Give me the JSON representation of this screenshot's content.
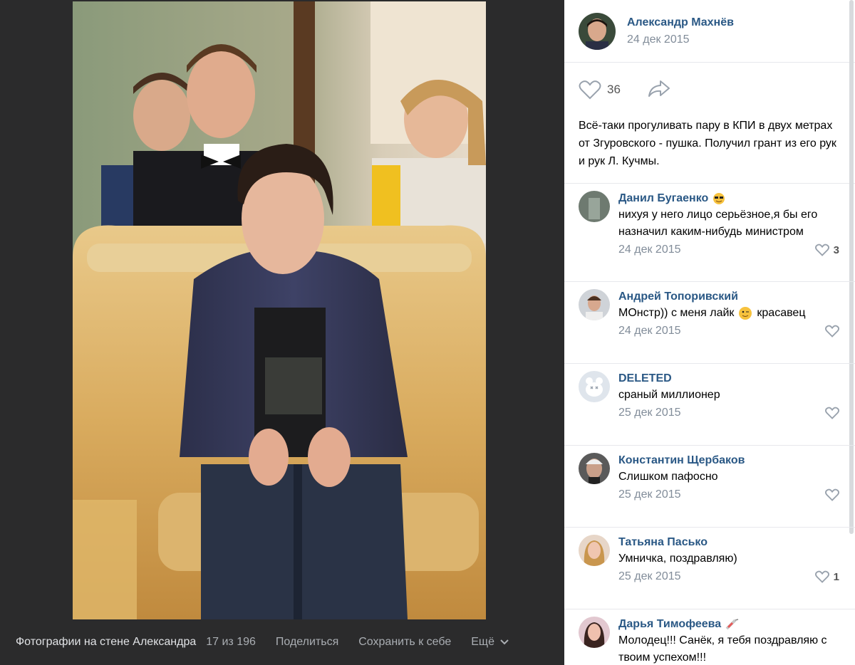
{
  "viewer": {
    "album_title": "Фотографии на стене Александра",
    "counter": "17 из 196",
    "share_label": "Поделиться",
    "save_label": "Сохранить к себе",
    "more_label": "Ещё"
  },
  "post": {
    "author": "Александр Махнёв",
    "date": "24 дек 2015",
    "likes": "36",
    "text": "Всё-таки прогуливать пару в КПИ в двух метрах от Згуровского - пушка. Получил грант из его рук и рук Л. Кучмы."
  },
  "comments": [
    {
      "name": "Данил Бугаенко",
      "text": "нихуя у него лицо серьёзное,я бы его назначил каким-нибудь министром",
      "date": "24 дек 2015",
      "likes": "3",
      "emoji": "sunglasses"
    },
    {
      "name": "Андрей Топоривский",
      "text_before": "МОнстр)) с меня лайк",
      "text_after": "красавец",
      "date": "24 дек 2015",
      "likes": "",
      "emoji": "wink"
    },
    {
      "name": "DELETED",
      "text": "сраный миллионер",
      "date": "25 дек 2015",
      "likes": ""
    },
    {
      "name": "Константин Щербаков",
      "text": "Слишком пафосно",
      "date": "25 дек 2015",
      "likes": ""
    },
    {
      "name": "Татьяна Пасько",
      "text": "Умничка, поздравляю)",
      "date": "25 дек 2015",
      "likes": "1"
    },
    {
      "name": "Дарья Тимофеева",
      "text": "Молодец!!! Санёк, я тебя поздравляю с твоим успехом!!!",
      "date": "",
      "likes": "",
      "emoji": "syringe"
    }
  ],
  "colors": {
    "link": "#2a5885",
    "muted": "#818c99",
    "dark_bg": "#2b2b2c"
  }
}
